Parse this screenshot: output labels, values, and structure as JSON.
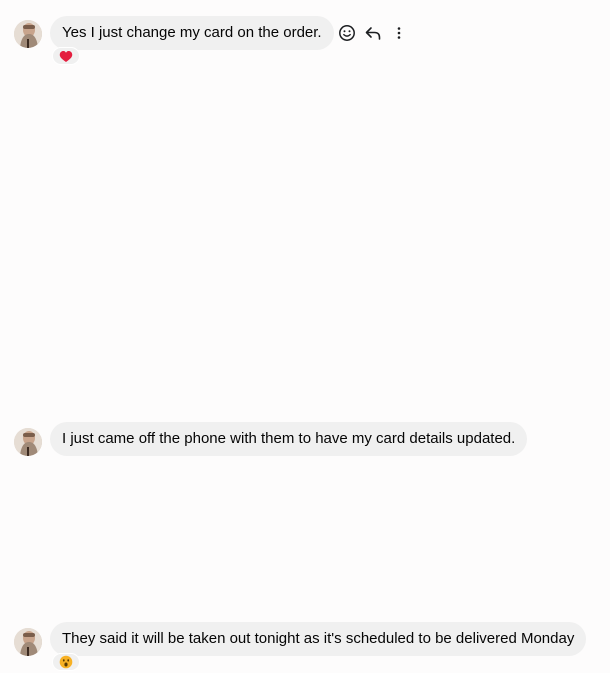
{
  "messages": [
    {
      "text": "Yes I just change my card on the order.",
      "reaction": "heart",
      "hover_actions": [
        "react-icon",
        "reply-icon",
        "more-icon"
      ]
    },
    {
      "text": "I just came off the phone with them to have my card details updated.",
      "reaction": null
    },
    {
      "text": "They said it will be taken out tonight as it's scheduled to be delivered Monday",
      "reaction": "wow"
    }
  ],
  "colors": {
    "background": "#fdfcfc",
    "bubble": "#f0f0f0",
    "text": "#050505",
    "heart": "#e41e3f",
    "wow": "#f7b125"
  }
}
